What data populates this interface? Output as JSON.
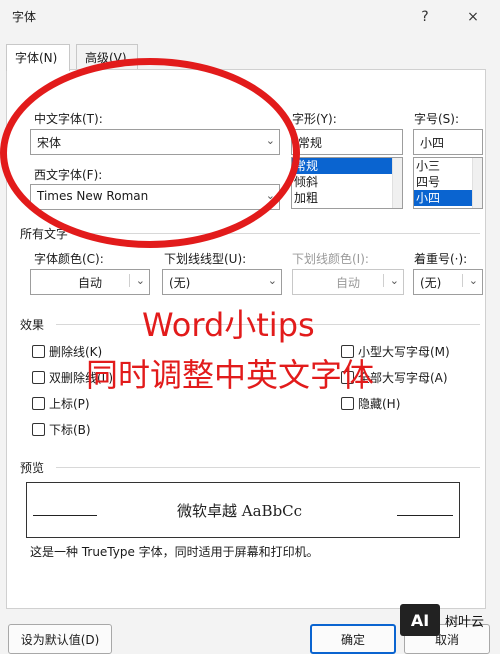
{
  "window": {
    "title": "字体",
    "help_icon": "?",
    "close_icon": "×"
  },
  "tabs": [
    {
      "label": "字体(N)",
      "active": true
    },
    {
      "label": "高级(V)",
      "active": false
    }
  ],
  "chinese_font": {
    "label": "中文字体(T):",
    "value": "宋体"
  },
  "western_font": {
    "label": "西文字体(F):",
    "value": "Times New Roman"
  },
  "font_style": {
    "label": "字形(Y):",
    "value": "常规",
    "options": [
      "常规",
      "倾斜",
      "加粗"
    ],
    "selected": "常规"
  },
  "font_size": {
    "label": "字号(S):",
    "value": "小四",
    "options": [
      "小三",
      "四号",
      "小四"
    ],
    "selected": "小四"
  },
  "all_text": {
    "section_label": "所有文字",
    "font_color": {
      "label": "字体颜色(C):",
      "value": "自动"
    },
    "underline_style": {
      "label": "下划线线型(U):",
      "value": "(无)"
    },
    "underline_color": {
      "label": "下划线颜色(I):",
      "value": "自动"
    },
    "emphasis_mark": {
      "label": "着重号(·):",
      "value": "(无)"
    }
  },
  "effects": {
    "section_label": "效果",
    "left": [
      "删除线(K)",
      "双删除线(L)",
      "上标(P)",
      "下标(B)"
    ],
    "right": [
      "小型大写字母(M)",
      "全部大写字母(A)",
      "隐藏(H)"
    ]
  },
  "preview": {
    "section_label": "预览",
    "sample": "微软卓越  AaBbCc",
    "description": "这是一种 TrueType 字体，同时适用于屏幕和打印机。"
  },
  "buttons": {
    "default": "设为默认值(D)",
    "ok": "确定",
    "cancel": "取消"
  },
  "overlay": {
    "line1": "Word小tips",
    "line2": "同时调整中英文字体",
    "color": "#e21b1b"
  },
  "watermark": {
    "logo": "AI",
    "text": "树叶云"
  }
}
